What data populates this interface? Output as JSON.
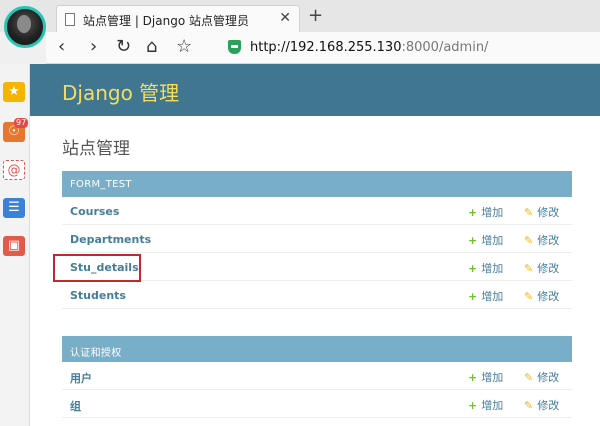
{
  "browser": {
    "tab_title": "站点管理 | Django 站点管理员",
    "tab_close": "✕",
    "new_tab": "+",
    "url_host": "http://192.168.255.130",
    "url_rest": ":8000/admin/"
  },
  "sidebar": {
    "weibo_badge": "97"
  },
  "header": {
    "brand": "Django 管理"
  },
  "content": {
    "title": "站点管理"
  },
  "modules": [
    {
      "caption": "FORM_TEST",
      "rows": [
        {
          "name": "Courses",
          "add": "增加",
          "change": "修改"
        },
        {
          "name": "Departments",
          "add": "增加",
          "change": "修改"
        },
        {
          "name": "Stu_details",
          "add": "增加",
          "change": "修改"
        },
        {
          "name": "Students",
          "add": "增加",
          "change": "修改"
        }
      ]
    },
    {
      "caption": "认证和授权",
      "rows": [
        {
          "name": "用户",
          "add": "增加",
          "change": "修改"
        },
        {
          "name": "组",
          "add": "增加",
          "change": "修改"
        }
      ]
    }
  ],
  "colors": {
    "header_bg": "#417690",
    "brand": "#f5dd5d",
    "caption_bg": "#79aec8",
    "link": "#447e9b",
    "add_icon": "#70bf2b",
    "change_icon": "#efb80b",
    "highlight": "#c0282d"
  }
}
